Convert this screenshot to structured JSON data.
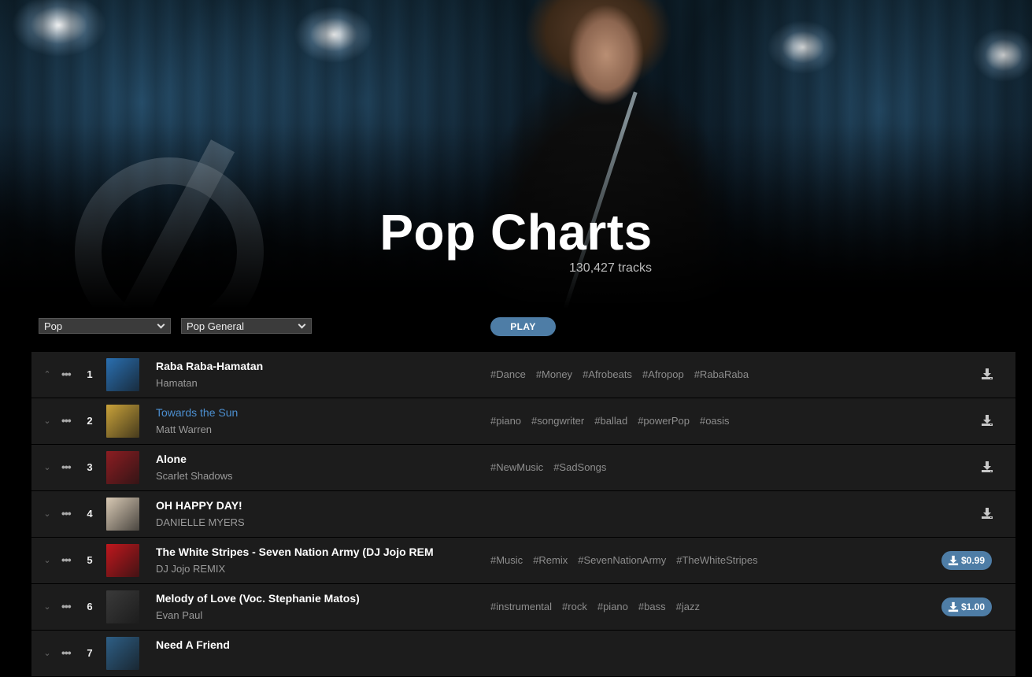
{
  "hero": {
    "title": "Pop Charts",
    "track_count": "130,427 tracks"
  },
  "filters": {
    "genre": "Pop",
    "subgenre": "Pop General",
    "play_label": "PLAY"
  },
  "colors": {
    "accent": "#4e7da6",
    "active_title": "#4c8fd0",
    "row_bg": "#1c1c1c"
  },
  "tracks": [
    {
      "rank": "1",
      "title": "Raba Raba-Hamatan",
      "artist": "Hamatan",
      "tags": [
        "#Dance",
        "#Money",
        "#Afrobeats",
        "#Afropop",
        "#RabaRaba"
      ],
      "price": "",
      "art_color": "#2a6fb0",
      "expand_icon": "chevrons-up-icon"
    },
    {
      "rank": "2",
      "title": "Towards the Sun",
      "artist": "Matt Warren",
      "tags": [
        "#piano",
        "#songwriter",
        "#ballad",
        "#powerPop",
        "#oasis"
      ],
      "price": "",
      "art_color": "#c9a23a",
      "active": true,
      "expand_icon": "chevron-down-icon"
    },
    {
      "rank": "3",
      "title": "Alone",
      "artist": "Scarlet Shadows",
      "tags": [
        "#NewMusic",
        "#SadSongs"
      ],
      "price": "",
      "art_color": "#8c1d22",
      "expand_icon": "chevron-down-icon"
    },
    {
      "rank": "4",
      "title": "OH HAPPY DAY!",
      "artist": "DANIELLE MYERS",
      "tags": [],
      "price": "",
      "art_color": "#d8c9b4",
      "expand_icon": "chevron-down-icon"
    },
    {
      "rank": "5",
      "title": "The White Stripes - Seven Nation Army (DJ Jojo REM",
      "artist": "DJ Jojo REMIX",
      "tags": [
        "#Music",
        "#Remix",
        "#SevenNationArmy",
        "#TheWhiteStripes"
      ],
      "price": "$0.99",
      "art_color": "#c0171d",
      "expand_icon": "chevron-down-icon"
    },
    {
      "rank": "6",
      "title": "Melody of Love (Voc. Stephanie Matos)",
      "artist": "Evan Paul",
      "tags": [
        "#instrumental",
        "#rock",
        "#piano",
        "#bass",
        "#jazz"
      ],
      "price": "$1.00",
      "art_color": "#3a3a3a",
      "expand_icon": "chevron-down-icon"
    },
    {
      "rank": "7",
      "title": "Need A Friend",
      "artist": "",
      "tags": [],
      "price": "",
      "art_color": "#2e5f86",
      "expand_icon": "chevron-down-icon"
    }
  ]
}
